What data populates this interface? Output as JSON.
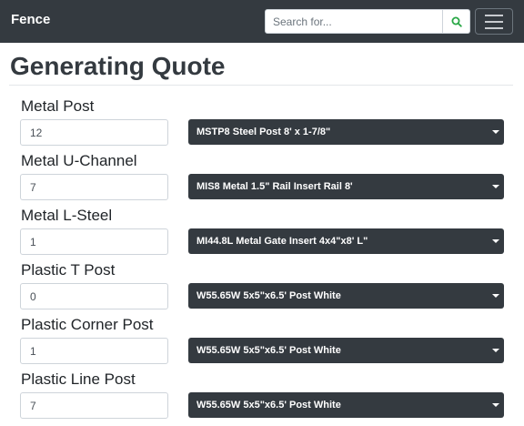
{
  "navbar": {
    "brand": "Fence",
    "search_placeholder": "Search for...",
    "search_icon": "search-icon",
    "menu_icon": "hamburger-menu-icon"
  },
  "page": {
    "title": "Generating Quote"
  },
  "items": [
    {
      "label": "Metal Post",
      "quantity": "12",
      "product": "MSTP8 Steel Post 8' x 1-7/8\""
    },
    {
      "label": "Metal U-Channel",
      "quantity": "7",
      "product": "MIS8 Metal 1.5\" Rail Insert Rail 8'"
    },
    {
      "label": "Metal L-Steel",
      "quantity": "1",
      "product": "MI44.8L Metal Gate Insert 4x4\"x8' L\""
    },
    {
      "label": "Plastic T Post",
      "quantity": "0",
      "product": "W55.65W 5x5\"x6.5' Post White"
    },
    {
      "label": "Plastic Corner Post",
      "quantity": "1",
      "product": "W55.65W 5x5\"x6.5' Post White"
    },
    {
      "label": "Plastic Line Post",
      "quantity": "7",
      "product": "W55.65W 5x5\"x6.5' Post White"
    }
  ],
  "colors": {
    "navbar": "#343a40",
    "select": "#343a40",
    "search_icon": "#28a745"
  }
}
